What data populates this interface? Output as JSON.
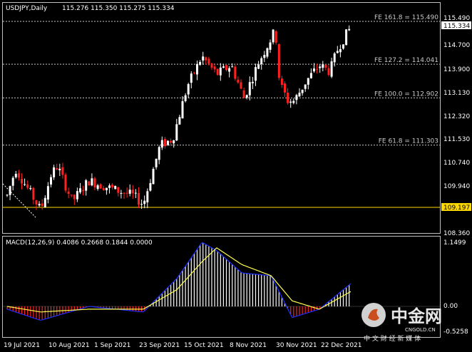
{
  "header": {
    "symbol": "USDJPY,Daily",
    "ohlc": "115.276 115.350 115.275 115.334"
  },
  "price_axis": {
    "ticks": [
      "115.490",
      "115.334",
      "114.700",
      "113.900",
      "113.130",
      "112.320",
      "111.530",
      "110.740",
      "109.940",
      "109.197",
      "108.360"
    ],
    "current_price": "115.334",
    "marked_level": "109.197"
  },
  "fib_levels": [
    {
      "label": "FE 161.8 = 115.490",
      "value": 115.49
    },
    {
      "label": "FE 127.2 = 114.041",
      "value": 114.041
    },
    {
      "label": "FE 100.0 = 112.902",
      "value": 112.902
    },
    {
      "label": "FE 61.8 = 111.303",
      "value": 111.303
    }
  ],
  "macd": {
    "label": "MACD(12,26,9) 0.4086 0.2668 0.1844 0.0000",
    "top_value": "1.1499",
    "zero_value": "0.00",
    "bottom_value": "-0.5258"
  },
  "date_axis": [
    "19 Jul 2021",
    "10 Aug 2021",
    "1 Sep 2021",
    "23 Sep 2021",
    "15 Oct 2021",
    "8 Nov 2021",
    "30 Nov 2021",
    "22 Dec 2021"
  ],
  "watermark": {
    "brand": "中金网",
    "slogan": "中 文 财 经 新 媒 体",
    "url": "CNGOLD.CN"
  },
  "colors": {
    "bull": "#ffffff",
    "bear": "#ff2020",
    "macd_line": "#2030ff",
    "signal_line": "#ffff50",
    "level_line": "#ffd700",
    "grid": "#c0c0c0"
  },
  "chart_data": {
    "type": "candlestick",
    "title": "USDJPY,Daily",
    "x_range": [
      "2021-07-19",
      "2021-12-30"
    ],
    "ylim": [
      108.0,
      115.8
    ],
    "close_path": [
      {
        "date": "2021-07-19",
        "close": 109.6
      },
      {
        "date": "2021-07-23",
        "close": 110.5
      },
      {
        "date": "2021-07-30",
        "close": 109.7
      },
      {
        "date": "2021-08-04",
        "close": 109.1
      },
      {
        "date": "2021-08-09",
        "close": 110.3
      },
      {
        "date": "2021-08-12",
        "close": 110.6
      },
      {
        "date": "2021-08-19",
        "close": 109.4
      },
      {
        "date": "2021-08-27",
        "close": 110.1
      },
      {
        "date": "2021-09-08",
        "close": 109.8
      },
      {
        "date": "2021-09-17",
        "close": 109.6
      },
      {
        "date": "2021-09-22",
        "close": 109.3
      },
      {
        "date": "2021-09-30",
        "close": 111.3
      },
      {
        "date": "2021-10-06",
        "close": 111.5
      },
      {
        "date": "2021-10-13",
        "close": 113.3
      },
      {
        "date": "2021-10-20",
        "close": 114.3
      },
      {
        "date": "2021-10-27",
        "close": 113.7
      },
      {
        "date": "2021-11-03",
        "close": 114.0
      },
      {
        "date": "2021-11-09",
        "close": 112.9
      },
      {
        "date": "2021-11-16",
        "close": 114.1
      },
      {
        "date": "2021-11-24",
        "close": 115.2
      },
      {
        "date": "2021-11-26",
        "close": 113.4
      },
      {
        "date": "2021-11-30",
        "close": 112.8
      },
      {
        "date": "2021-12-03",
        "close": 112.8
      },
      {
        "date": "2021-12-09",
        "close": 113.5
      },
      {
        "date": "2021-12-15",
        "close": 114.0
      },
      {
        "date": "2021-12-20",
        "close": 113.8
      },
      {
        "date": "2021-12-24",
        "close": 114.6
      },
      {
        "date": "2021-12-30",
        "close": 115.3
      }
    ],
    "macd_path": [
      {
        "date": "2021-07-19",
        "macd": -0.05,
        "signal": 0.0
      },
      {
        "date": "2021-08-04",
        "macd": -0.25,
        "signal": -0.1
      },
      {
        "date": "2021-08-27",
        "macd": 0.0,
        "signal": -0.05
      },
      {
        "date": "2021-09-22",
        "macd": -0.1,
        "signal": -0.05
      },
      {
        "date": "2021-10-08",
        "macd": 0.5,
        "signal": 0.3
      },
      {
        "date": "2021-10-20",
        "macd": 1.15,
        "signal": 0.8
      },
      {
        "date": "2021-10-27",
        "macd": 1.0,
        "signal": 1.05
      },
      {
        "date": "2021-11-08",
        "macd": 0.6,
        "signal": 0.75
      },
      {
        "date": "2021-11-22",
        "macd": 0.55,
        "signal": 0.55
      },
      {
        "date": "2021-12-02",
        "macd": -0.2,
        "signal": 0.1
      },
      {
        "date": "2021-12-15",
        "macd": -0.05,
        "signal": -0.05
      },
      {
        "date": "2021-12-30",
        "macd": 0.4086,
        "signal": 0.2668
      }
    ]
  }
}
